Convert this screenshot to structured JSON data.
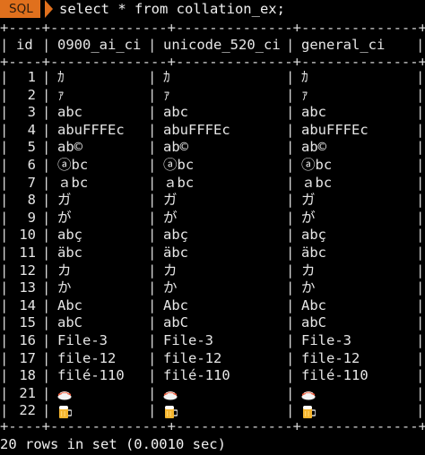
{
  "prompt": {
    "badge": "SQL",
    "command": "select * from collation_ex;"
  },
  "table": {
    "border": "+----+--------------+--------------+--------------+",
    "columns": [
      "id",
      "0900_ai_ci",
      "unicode_520_ci",
      "general_ci"
    ],
    "rows": [
      {
        "id": "1",
        "c1": "ｶ",
        "c2": "ｶ",
        "c3": "ｶ"
      },
      {
        "id": "2",
        "c1": "ｧ",
        "c2": "ｧ",
        "c3": "ｧ"
      },
      {
        "id": "3",
        "c1": "abc",
        "c2": "abc",
        "c3": "abc"
      },
      {
        "id": "4",
        "c1": "abuFFFEc",
        "c2": "abuFFFEc",
        "c3": "abuFFFEc"
      },
      {
        "id": "5",
        "c1": "ab©",
        "c2": "ab©",
        "c3": "ab©"
      },
      {
        "id": "6",
        "c1": "ⓐbc",
        "c2": "ⓐbc",
        "c3": "ⓐbc"
      },
      {
        "id": "7",
        "c1": "ａbc",
        "c2": "ａbc",
        "c3": "ａbc"
      },
      {
        "id": "8",
        "c1": "ガ",
        "c2": "ガ",
        "c3": "ガ"
      },
      {
        "id": "9",
        "c1": "が",
        "c2": "が",
        "c3": "が"
      },
      {
        "id": "10",
        "c1": "abç",
        "c2": "abç",
        "c3": "abç"
      },
      {
        "id": "11",
        "c1": "äbc",
        "c2": "äbc",
        "c3": "äbc"
      },
      {
        "id": "12",
        "c1": "カ",
        "c2": "カ",
        "c3": "カ"
      },
      {
        "id": "13",
        "c1": "か",
        "c2": "か",
        "c3": "か"
      },
      {
        "id": "14",
        "c1": "Abc",
        "c2": "Abc",
        "c3": "Abc"
      },
      {
        "id": "15",
        "c1": "abC",
        "c2": "abC",
        "c3": "abC"
      },
      {
        "id": "16",
        "c1": "File-3",
        "c2": "File-3",
        "c3": "File-3"
      },
      {
        "id": "17",
        "c1": "file-12",
        "c2": "file-12",
        "c3": "file-12"
      },
      {
        "id": "18",
        "c1": "filé-110",
        "c2": "filé-110",
        "c3": "filé-110"
      },
      {
        "id": "21",
        "c1": "sushi-icon",
        "c2": "sushi-icon",
        "c3": "sushi-icon"
      },
      {
        "id": "22",
        "c1": "beer-icon",
        "c2": "beer-icon",
        "c3": "beer-icon"
      }
    ]
  },
  "footer": "20 rows in set (0.0010 sec)",
  "colors": {
    "badge": "#e0701d",
    "background": "#000000",
    "text": "#e6e6e6"
  }
}
